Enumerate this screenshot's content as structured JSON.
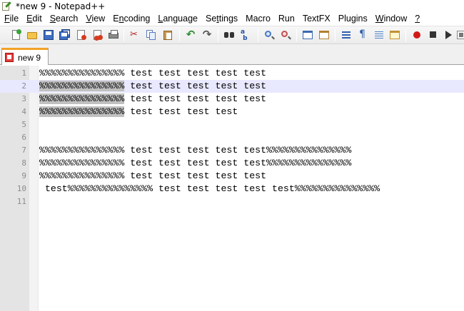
{
  "window": {
    "title": "*new  9 - Notepad++"
  },
  "menu": [
    {
      "pre": "",
      "ul": "F",
      "post": "ile"
    },
    {
      "pre": "",
      "ul": "E",
      "post": "dit"
    },
    {
      "pre": "",
      "ul": "S",
      "post": "earch"
    },
    {
      "pre": "",
      "ul": "V",
      "post": "iew"
    },
    {
      "pre": "E",
      "ul": "n",
      "post": "coding"
    },
    {
      "pre": "",
      "ul": "L",
      "post": "anguage"
    },
    {
      "pre": "Se",
      "ul": "t",
      "post": "tings"
    },
    {
      "pre": "Macro",
      "ul": "",
      "post": ""
    },
    {
      "pre": "Run",
      "ul": "",
      "post": ""
    },
    {
      "pre": "TextFX",
      "ul": "",
      "post": ""
    },
    {
      "pre": "Plugins",
      "ul": "",
      "post": ""
    },
    {
      "pre": "",
      "ul": "W",
      "post": "indow"
    },
    {
      "pre": "",
      "ul": "?",
      "post": ""
    }
  ],
  "toolbar": {
    "icons": [
      "new-file-icon",
      "open-file-icon",
      "save-icon",
      "save-all-icon",
      "close-icon",
      "close-all-icon",
      "print-icon",
      "cut-icon",
      "copy-icon",
      "paste-icon",
      "undo-icon",
      "redo-icon",
      "find-icon",
      "replace-icon",
      "zoom-in-icon",
      "zoom-out-icon",
      "sync-vertical-icon",
      "sync-horizontal-icon",
      "word-wrap-icon",
      "show-all-chars-icon",
      "indent-guide-icon",
      "user-language-icon",
      "record-macro-icon",
      "stop-record-icon",
      "playback-icon",
      "save-macro-icon"
    ]
  },
  "tabs": [
    {
      "label": "new  9",
      "active": true
    }
  ],
  "editor": {
    "current_line": 2,
    "lines": [
      {
        "num": "1",
        "sel": "",
        "text": "%%%%%%%%%%%%%%% test test test test test"
      },
      {
        "num": "2",
        "sel": "%%%%%%%%%%%%%%%",
        "text": " test test test test test"
      },
      {
        "num": "3",
        "sel": "%%%%%%%%%%%%%%%",
        "text": " test test test test test"
      },
      {
        "num": "4",
        "sel": "%%%%%%%%%%%%%%%",
        "text": " test test test test"
      },
      {
        "num": "5",
        "sel": "",
        "text": ""
      },
      {
        "num": "6",
        "sel": "",
        "text": ""
      },
      {
        "num": "7",
        "sel": "",
        "text": "%%%%%%%%%%%%%%% test test test test test%%%%%%%%%%%%%%%"
      },
      {
        "num": "8",
        "sel": "",
        "text": "%%%%%%%%%%%%%%% test test test test test%%%%%%%%%%%%%%%"
      },
      {
        "num": "9",
        "sel": "",
        "text": "%%%%%%%%%%%%%%% test test test test test"
      },
      {
        "num": "10",
        "sel": "",
        "text": " test%%%%%%%%%%%%%%% test test test test test%%%%%%%%%%%%%%%"
      },
      {
        "num": "11",
        "sel": "",
        "text": ""
      }
    ]
  }
}
